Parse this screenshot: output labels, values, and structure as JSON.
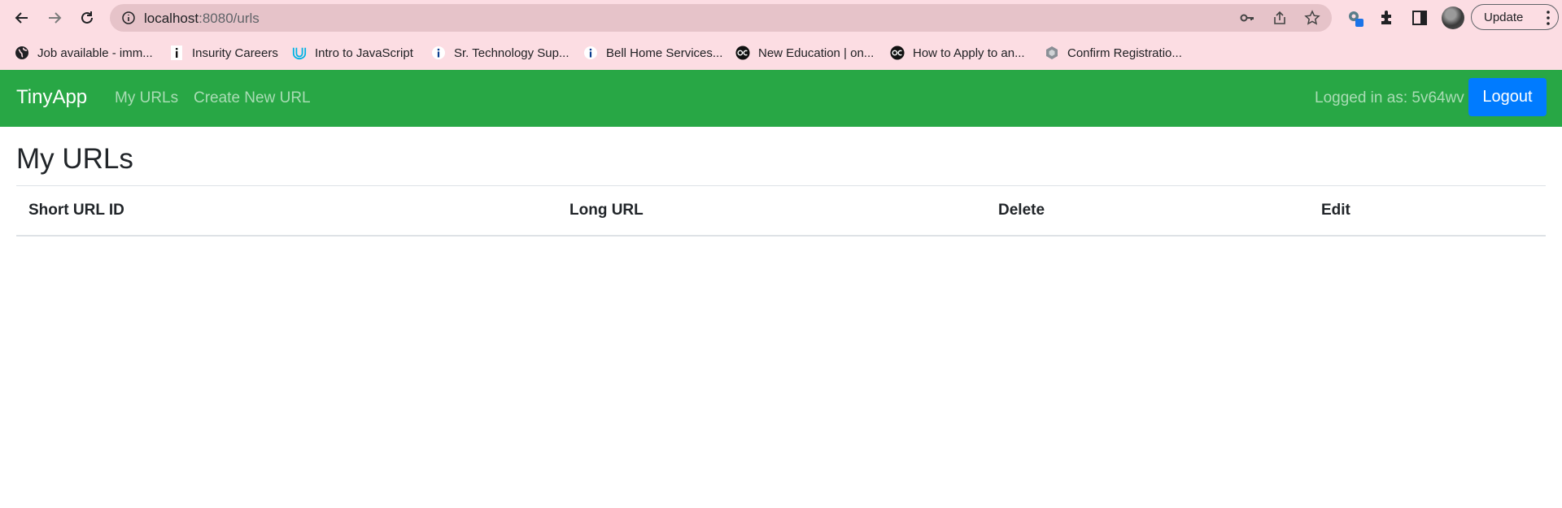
{
  "browser": {
    "url_host": "localhost",
    "url_path": ":8080/urls",
    "update_label": "Update",
    "bookmarks": [
      {
        "label": "Job available - imm...",
        "icon": "globe-icon"
      },
      {
        "label": "Insurity Careers",
        "icon": "insurity-icon"
      },
      {
        "label": "Intro to JavaScript",
        "icon": "udacity-icon"
      },
      {
        "label": "Sr. Technology Sup...",
        "icon": "info-icon"
      },
      {
        "label": "Bell Home Services...",
        "icon": "info-icon"
      },
      {
        "label": "New Education | on...",
        "icon": "dc-icon"
      },
      {
        "label": "How to Apply to an...",
        "icon": "dc-icon"
      },
      {
        "label": "Confirm Registratio...",
        "icon": "hex-icon"
      }
    ]
  },
  "navbar": {
    "brand": "TinyApp",
    "links": [
      "My URLs",
      "Create New URL"
    ],
    "logged_in_text": "Logged in as: 5v64wv",
    "logout_label": "Logout",
    "color": "#28a745",
    "logout_color": "#007bff"
  },
  "main": {
    "title": "My URLs",
    "table": {
      "headers": [
        "Short URL ID",
        "Long URL",
        "Delete",
        "Edit"
      ],
      "rows": []
    }
  }
}
